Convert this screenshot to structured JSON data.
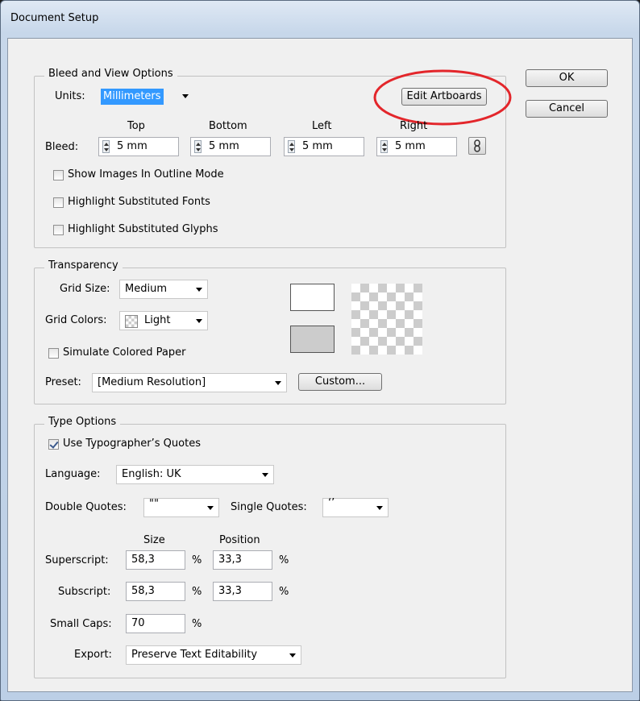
{
  "window": {
    "title": "Document Setup"
  },
  "bleed_view": {
    "legend": "Bleed and View Options",
    "units_label": "Units:",
    "units_value": "Millimeters",
    "edit_artboards": "Edit Artboards",
    "bleed_label": "Bleed:",
    "headers": {
      "top": "Top",
      "bottom": "Bottom",
      "left": "Left",
      "right": "Right"
    },
    "values": {
      "top": "5 mm",
      "bottom": "5 mm",
      "left": "5 mm",
      "right": "5 mm"
    },
    "link_icon": "chain-link-icon",
    "options": [
      {
        "label": "Show Images In Outline Mode",
        "checked": false
      },
      {
        "label": "Highlight Substituted Fonts",
        "checked": false
      },
      {
        "label": "Highlight Substituted Glyphs",
        "checked": false
      }
    ]
  },
  "transparency": {
    "legend": "Transparency",
    "grid_size_label": "Grid Size:",
    "grid_size_value": "Medium",
    "grid_colors_label": "Grid Colors:",
    "grid_colors_value": "Light",
    "simulate_label": "Simulate Colored Paper",
    "simulate_checked": false,
    "preset_label": "Preset:",
    "preset_value": "[Medium Resolution]",
    "custom_button": "Custom..."
  },
  "type_options": {
    "legend": "Type Options",
    "typographers_quotes": "Use Typographer’s Quotes",
    "typographers_checked": true,
    "language_label": "Language:",
    "language_value": "English: UK",
    "double_quotes_label": "Double Quotes:",
    "double_quotes_value": "\"\"",
    "single_quotes_label": "Single Quotes:",
    "single_quotes_value": "‘’",
    "size_header": "Size",
    "position_header": "Position",
    "superscript_label": "Superscript:",
    "superscript_size": "58,3",
    "superscript_position": "33,3",
    "subscript_label": "Subscript:",
    "subscript_size": "58,3",
    "subscript_position": "33,3",
    "percent": "%",
    "small_caps_label": "Small Caps:",
    "small_caps_value": "70",
    "export_label": "Export:",
    "export_value": "Preserve Text Editability"
  },
  "buttons": {
    "ok": "OK",
    "cancel": "Cancel"
  },
  "colors": {
    "highlight_circle": "#e3262b",
    "selection": "#3399ff"
  }
}
